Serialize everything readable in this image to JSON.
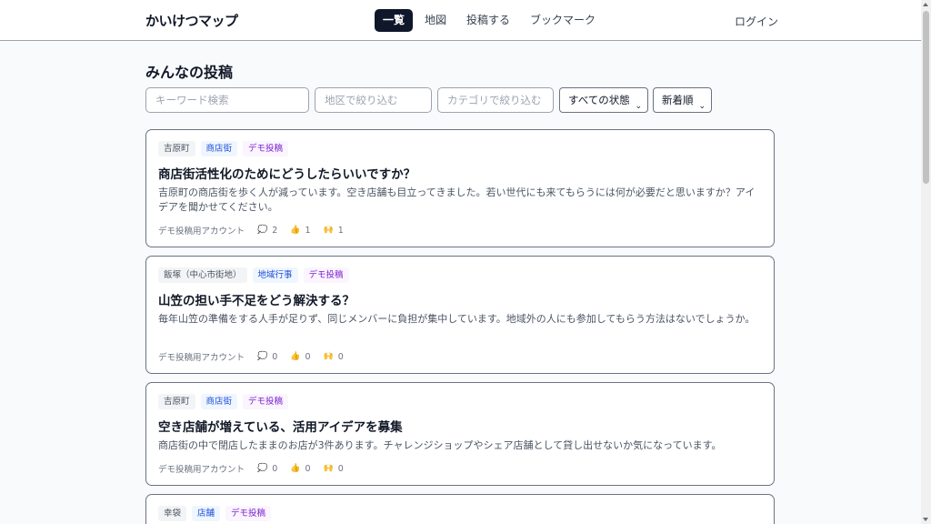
{
  "header": {
    "brand": "かいけつマップ",
    "nav": [
      "一覧",
      "地図",
      "投稿する",
      "ブックマーク"
    ],
    "login": "ログイン"
  },
  "page_title": "みんなの投稿",
  "filters": {
    "keyword_placeholder": "キーワード検索",
    "area_placeholder": "地区で絞り込む",
    "category_placeholder": "カテゴリで絞り込む",
    "status_select": "すべての状態",
    "sort_select": "新着順"
  },
  "posts": [
    {
      "tags": [
        "吉原町",
        "商店街",
        "デモ投稿"
      ],
      "title": "商店街活性化のためにどうしたらいいですか？",
      "body": "吉原町の商店街を歩く人が減っています。空き店舗も目立ってきました。若い世代にも来てもらうには何が必要だと思いますか？アイデアを聞かせてください。",
      "author": "デモ投稿用アカウント",
      "comments": "2",
      "likes": "1",
      "claps": "1"
    },
    {
      "tags": [
        "飯塚（中心市街地）",
        "地域行事",
        "デモ投稿"
      ],
      "title": "山笠の担い手不足をどう解決する？",
      "body": "毎年山笠の準備をする人手が足りず、同じメンバーに負担が集中しています。地域外の人にも参加してもらう方法はないでしょうか。",
      "author": "デモ投稿用アカウント",
      "comments": "0",
      "likes": "0",
      "claps": "0"
    },
    {
      "tags": [
        "吉原町",
        "商店街",
        "デモ投稿"
      ],
      "title": "空き店舗が増えている、活用アイデアを募集",
      "body": "商店街の中で閉店したままのお店が3件あります。チャレンジショップやシェア店舗として貸し出せないか気になっています。",
      "author": "デモ投稿用アカウント",
      "comments": "0",
      "likes": "0",
      "claps": "0"
    },
    {
      "tags": [
        "幸袋",
        "店舗",
        "デモ投稿"
      ]
    }
  ],
  "icons": {
    "comment": "comment-icon",
    "like": "thumbs-up-icon",
    "clap": "clap-icon"
  },
  "colors": {
    "nav_active_bg": "#0f172a",
    "tag_area": "#4b5563",
    "tag_category": "#1d4ed8",
    "tag_demo": "#7e22ce"
  }
}
